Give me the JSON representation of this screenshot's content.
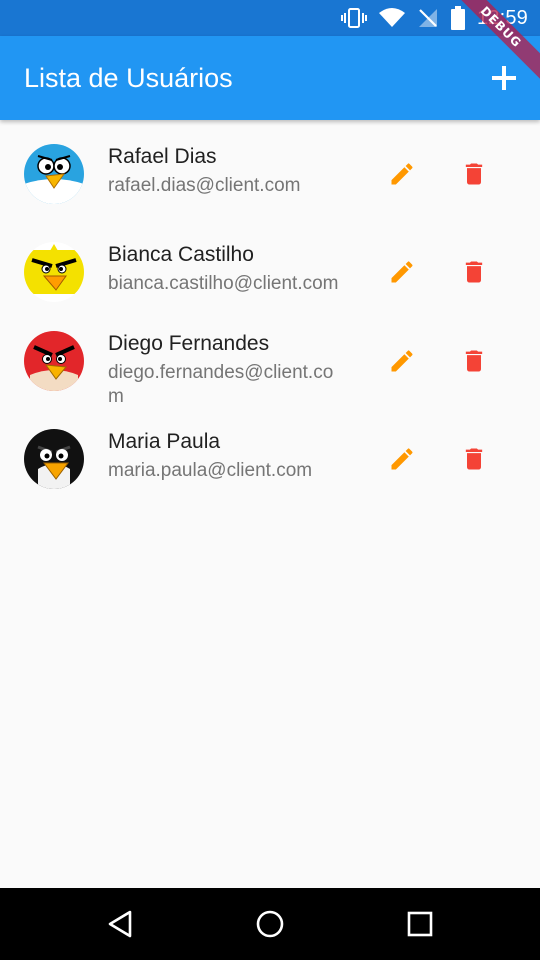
{
  "status_bar": {
    "time": "12:59"
  },
  "app_bar": {
    "title": "Lista de Usuários",
    "add_icon": "plus-icon"
  },
  "debug_banner": "DEBUG",
  "users": [
    {
      "name": "Rafael Dias",
      "email": "rafael.dias@client.com",
      "avatar": "blue-bird"
    },
    {
      "name": "Bianca Castilho",
      "email": "bianca.castilho@client.com",
      "avatar": "yellow-bird"
    },
    {
      "name": "Diego Fernandes",
      "email": "diego.fernandes@client.com",
      "avatar": "red-bird"
    },
    {
      "name": "Maria Paula",
      "email": "maria.paula@client.com",
      "avatar": "black-bird"
    }
  ],
  "colors": {
    "status_bar": "#1976d2",
    "app_bar": "#2196f3",
    "edit_icon": "#ff9800",
    "delete_icon": "#f44336",
    "background": "#fafafa"
  },
  "nav_bar": {
    "buttons": [
      "back-icon",
      "home-icon",
      "recents-icon"
    ]
  }
}
